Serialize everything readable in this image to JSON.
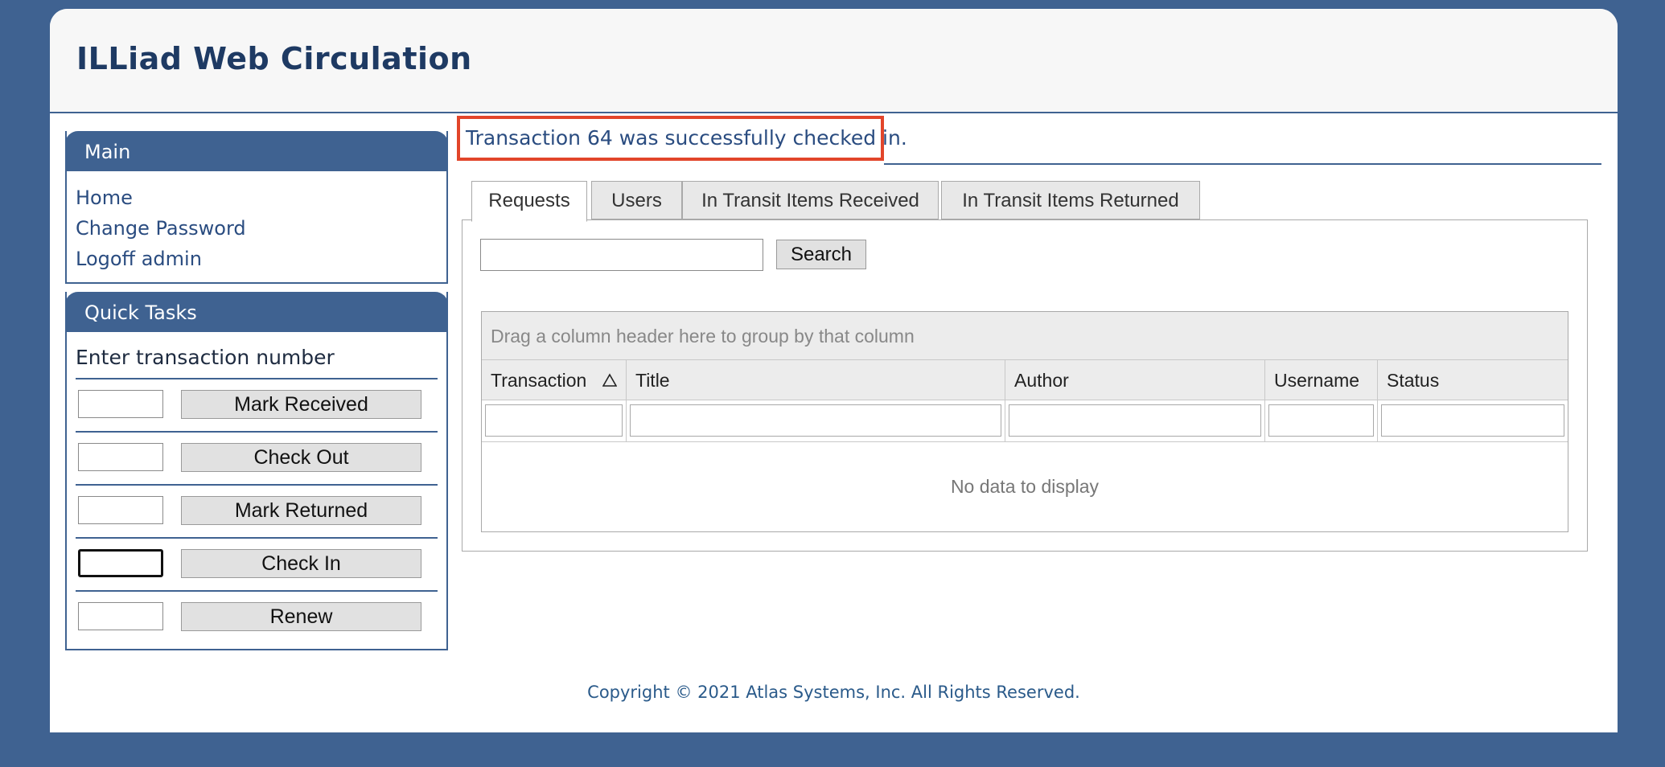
{
  "app": {
    "title": "ILLiad Web Circulation"
  },
  "sidebar": {
    "main": {
      "heading": "Main",
      "links": [
        {
          "label": "Home"
        },
        {
          "label": "Change Password"
        },
        {
          "label": "Logoff admin"
        }
      ]
    },
    "quick_tasks": {
      "heading": "Quick Tasks",
      "prompt": "Enter transaction number",
      "actions": [
        {
          "label": "Mark Received",
          "value": ""
        },
        {
          "label": "Check Out",
          "value": ""
        },
        {
          "label": "Mark Returned",
          "value": ""
        },
        {
          "label": "Check In",
          "value": "",
          "focused": true
        },
        {
          "label": "Renew",
          "value": ""
        }
      ]
    }
  },
  "message": {
    "text": "Transaction 64 was successfully checked in."
  },
  "tabs": [
    {
      "label": "Requests",
      "active": true
    },
    {
      "label": "Users",
      "active": false
    },
    {
      "label": "In Transit Items Received",
      "active": false
    },
    {
      "label": "In Transit Items Returned",
      "active": false
    }
  ],
  "search": {
    "value": "",
    "button_label": "Search"
  },
  "grid": {
    "group_hint": "Drag a column header here to group by that column",
    "columns": [
      "Transaction",
      "Title",
      "Author",
      "Username",
      "Status"
    ],
    "sort_column": "Transaction",
    "sort_direction": "ascending",
    "empty_text": "No data to display",
    "rows": []
  },
  "footer": {
    "copyright": "Copyright © 2021 Atlas Systems, Inc. All Rights Reserved."
  },
  "colors": {
    "page_background": "#3f6291",
    "accent": "#3f6291",
    "title_text": "#1e3a63",
    "link_text": "#2a4c80",
    "highlight_border": "#e2452a"
  }
}
